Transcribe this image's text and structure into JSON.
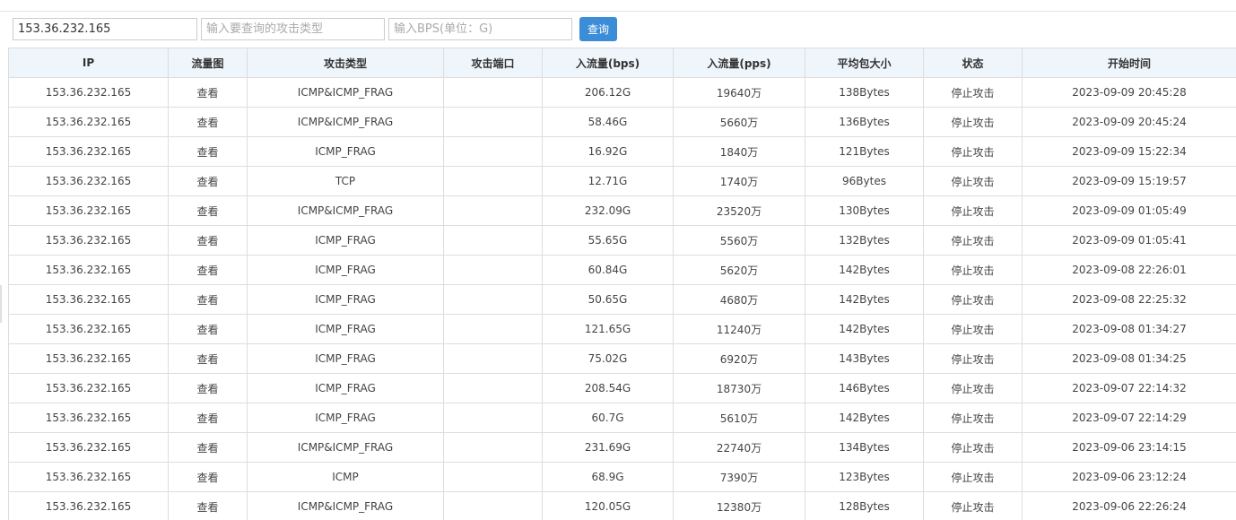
{
  "search": {
    "ip_value": "153.36.232.165",
    "type_placeholder": "输入要查询的攻击类型",
    "bps_placeholder": "输入BPS(单位：G)",
    "query_label": "查询"
  },
  "table": {
    "columns": [
      "IP",
      "流量图",
      "攻击类型",
      "攻击端口",
      "入流量(bps)",
      "入流量(pps)",
      "平均包大小",
      "状态",
      "开始时间"
    ],
    "rows": [
      [
        "153.36.232.165",
        "查看",
        "ICMP&ICMP_FRAG",
        "",
        "206.12G",
        "19640万",
        "138Bytes",
        "停止攻击",
        "2023-09-09 20:45:28"
      ],
      [
        "153.36.232.165",
        "查看",
        "ICMP&ICMP_FRAG",
        "",
        "58.46G",
        "5660万",
        "136Bytes",
        "停止攻击",
        "2023-09-09 20:45:24"
      ],
      [
        "153.36.232.165",
        "查看",
        "ICMP_FRAG",
        "",
        "16.92G",
        "1840万",
        "121Bytes",
        "停止攻击",
        "2023-09-09 15:22:34"
      ],
      [
        "153.36.232.165",
        "查看",
        "TCP",
        "",
        "12.71G",
        "1740万",
        "96Bytes",
        "停止攻击",
        "2023-09-09 15:19:57"
      ],
      [
        "153.36.232.165",
        "查看",
        "ICMP&ICMP_FRAG",
        "",
        "232.09G",
        "23520万",
        "130Bytes",
        "停止攻击",
        "2023-09-09 01:05:49"
      ],
      [
        "153.36.232.165",
        "查看",
        "ICMP_FRAG",
        "",
        "55.65G",
        "5560万",
        "132Bytes",
        "停止攻击",
        "2023-09-09 01:05:41"
      ],
      [
        "153.36.232.165",
        "查看",
        "ICMP_FRAG",
        "",
        "60.84G",
        "5620万",
        "142Bytes",
        "停止攻击",
        "2023-09-08 22:26:01"
      ],
      [
        "153.36.232.165",
        "查看",
        "ICMP_FRAG",
        "",
        "50.65G",
        "4680万",
        "142Bytes",
        "停止攻击",
        "2023-09-08 22:25:32"
      ],
      [
        "153.36.232.165",
        "查看",
        "ICMP_FRAG",
        "",
        "121.65G",
        "11240万",
        "142Bytes",
        "停止攻击",
        "2023-09-08 01:34:27"
      ],
      [
        "153.36.232.165",
        "查看",
        "ICMP_FRAG",
        "",
        "75.02G",
        "6920万",
        "143Bytes",
        "停止攻击",
        "2023-09-08 01:34:25"
      ],
      [
        "153.36.232.165",
        "查看",
        "ICMP_FRAG",
        "",
        "208.54G",
        "18730万",
        "146Bytes",
        "停止攻击",
        "2023-09-07 22:14:32"
      ],
      [
        "153.36.232.165",
        "查看",
        "ICMP_FRAG",
        "",
        "60.7G",
        "5610万",
        "142Bytes",
        "停止攻击",
        "2023-09-07 22:14:29"
      ],
      [
        "153.36.232.165",
        "查看",
        "ICMP&ICMP_FRAG",
        "",
        "231.69G",
        "22740万",
        "134Bytes",
        "停止攻击",
        "2023-09-06 23:14:15"
      ],
      [
        "153.36.232.165",
        "查看",
        "ICMP",
        "",
        "68.9G",
        "7390万",
        "123Bytes",
        "停止攻击",
        "2023-09-06 23:12:24"
      ],
      [
        "153.36.232.165",
        "查看",
        "ICMP&ICMP_FRAG",
        "",
        "120.05G",
        "12380万",
        "128Bytes",
        "停止攻击",
        "2023-09-06 22:26:24"
      ]
    ]
  }
}
